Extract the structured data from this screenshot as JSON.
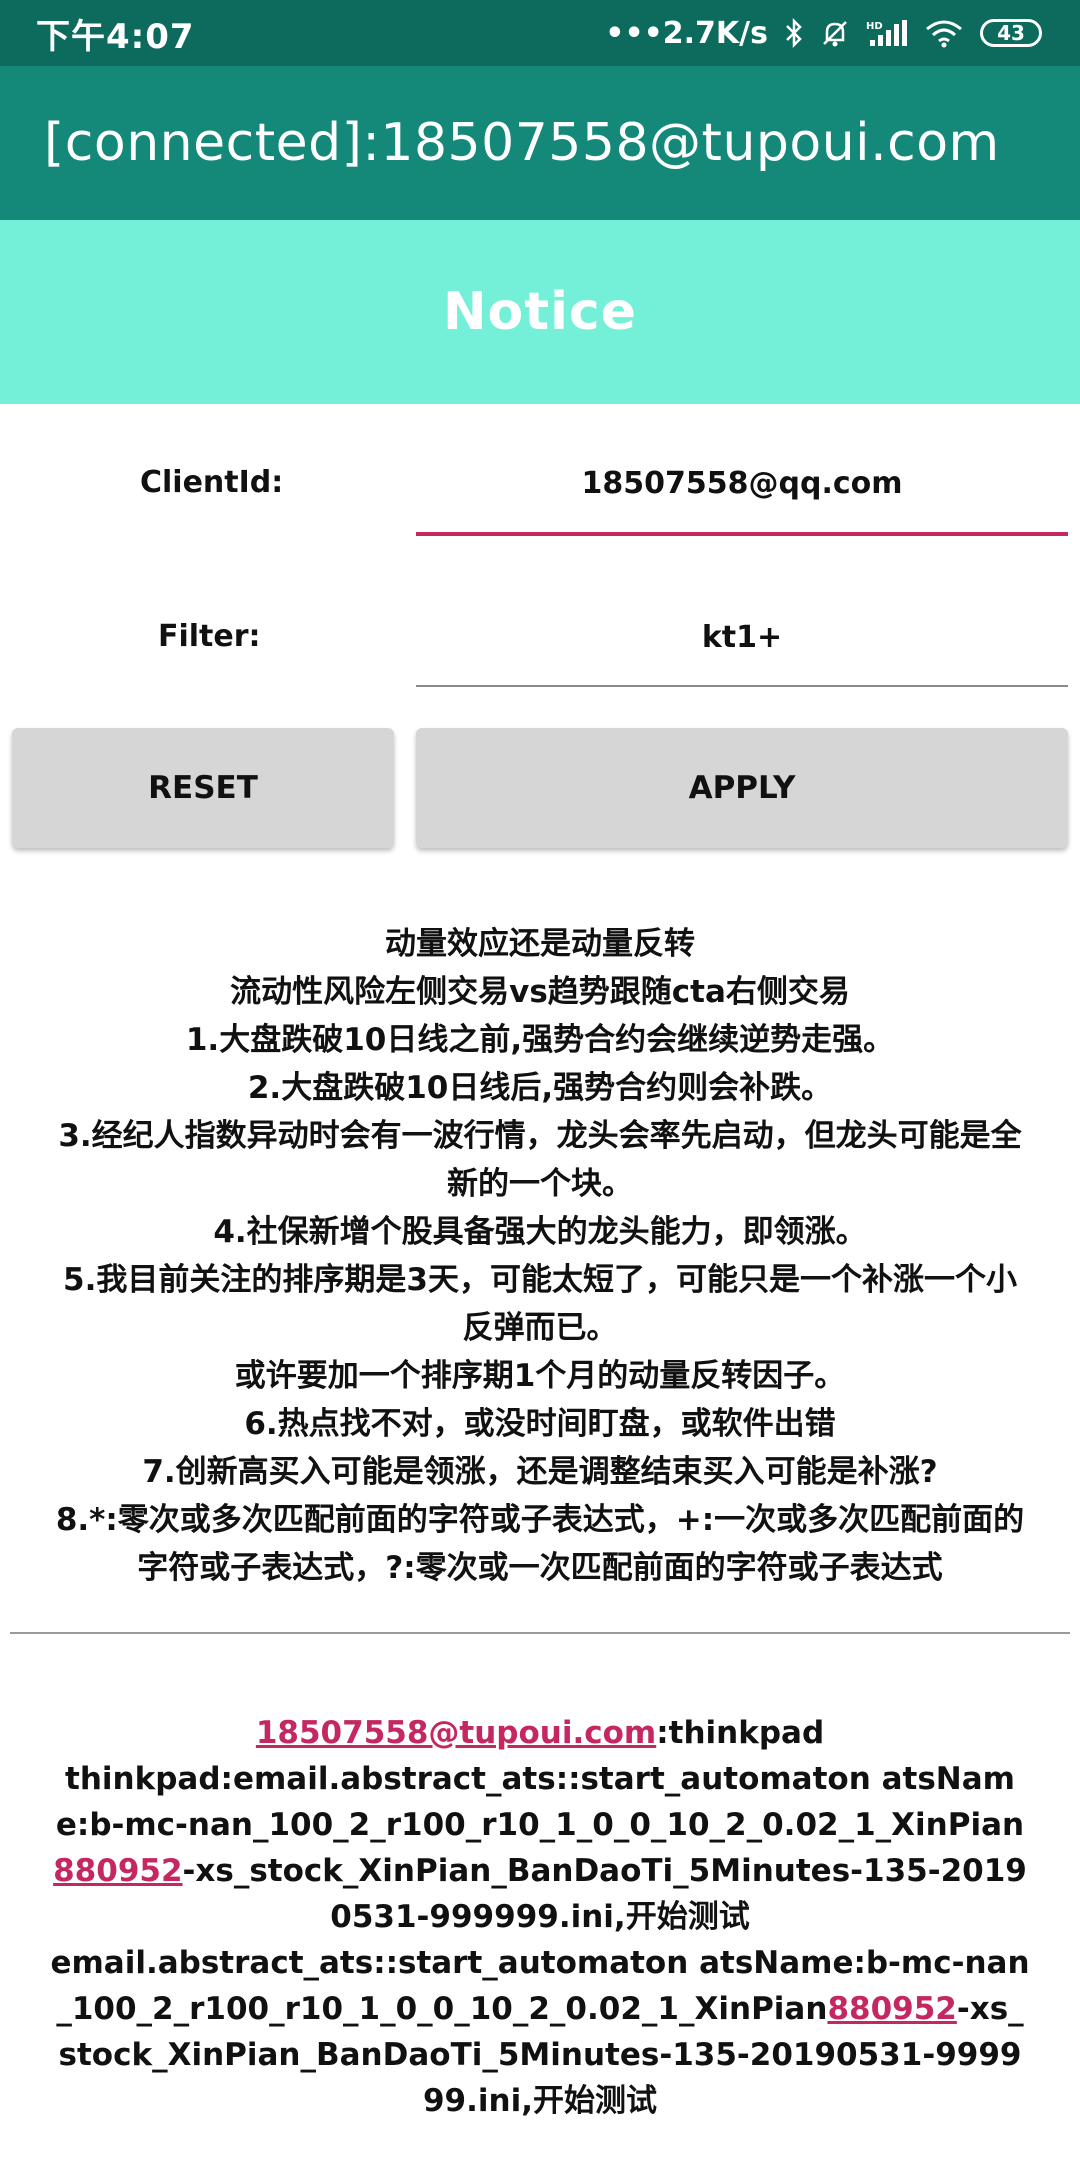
{
  "status_bar": {
    "time": "下午4:07",
    "net_speed": "•••2.7K/s",
    "battery_level": "43",
    "icons": [
      "bluetooth-icon",
      "mute-bell-icon",
      "hd-signal-icon",
      "wifi-icon",
      "battery-icon"
    ]
  },
  "app_bar": {
    "title": "[connected]:18507558@tupoui.com"
  },
  "banner": {
    "title": "Notice"
  },
  "form": {
    "client_id_label": "ClientId:",
    "client_id_value": "18507558@qq.com",
    "filter_label": "Filter:",
    "filter_value": "kt1+"
  },
  "buttons": {
    "reset": "RESET",
    "apply": "APPLY"
  },
  "notes": [
    "动量效应还是动量反转",
    "流动性风险左侧交易vs趋势跟随cta右侧交易",
    "1.大盘跌破10日线之前,强势合约会继续逆势走强。",
    "2.大盘跌破10日线后,强势合约则会补跌。",
    "3.经纪人指数异动时会有一波行情，龙头会率先启动，但龙头可能是全新的一个块。",
    "4.社保新增个股具备强大的龙头能力，即领涨。",
    "5.我目前关注的排序期是3天，可能太短了，可能只是一个补涨一个小反弹而已。",
    "或许要加一个排序期1个月的动量反转因子。",
    "6.热点找不对，或没时间盯盘，或软件出错",
    "7.创新高买入可能是领涨，还是调整结束买入可能是补涨?",
    "8.*:零次或多次匹配前面的字符或子表达式，+:一次或多次匹配前面的字符或子表达式，?:零次或一次匹配前面的字符或子表达式"
  ],
  "log": {
    "sender_link": "18507558@tupoui.com",
    "sender_suffix": ":thinkpad",
    "line1_prefix": "thinkpad:email.abstract_ats::start_automaton atsName:b-mc-nan_100_2_r100_r10_1_0_0_10_2_0.02_1_XinPian",
    "line1_link": "880952",
    "line1_suffix": "-xs_stock_XinPian_BanDaoTi_5Minutes-135-20190531-999999.ini,开始测试",
    "line2_prefix": "email.abstract_ats::start_automaton atsName:b-mc-nan_100_2_r100_r10_1_0_0_10_2_0.02_1_XinPian",
    "line2_link": "880952",
    "line2_suffix": "-xs_stock_XinPian_BanDaoTi_5Minutes-135-20190531-999999.ini,开始测试"
  },
  "colors": {
    "status_bar": "#0d6b5d",
    "app_bar": "#14897a",
    "banner": "#73f0d7",
    "accent": "#c42762",
    "button": "#d6d6d6"
  }
}
